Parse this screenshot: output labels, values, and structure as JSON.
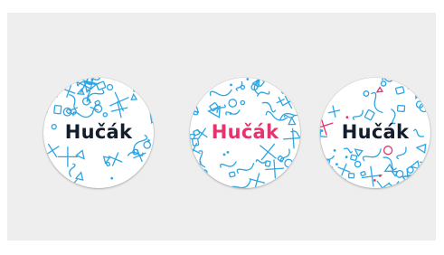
{
  "colors": {
    "background": "#eeeeee",
    "pattern_blue": "#2ea5e2",
    "accent_pink": "#e5336e",
    "ink_dark": "#141d2b"
  },
  "badges": [
    {
      "logo_text": "Hučák",
      "logo_color": "#141d2b",
      "pattern": "blue"
    },
    {
      "logo_text": "Hučák",
      "logo_color": "#e5336e",
      "pattern": "blue"
    },
    {
      "logo_text": "Hučák",
      "logo_color": "#141d2b",
      "pattern": "blue-pink"
    }
  ]
}
